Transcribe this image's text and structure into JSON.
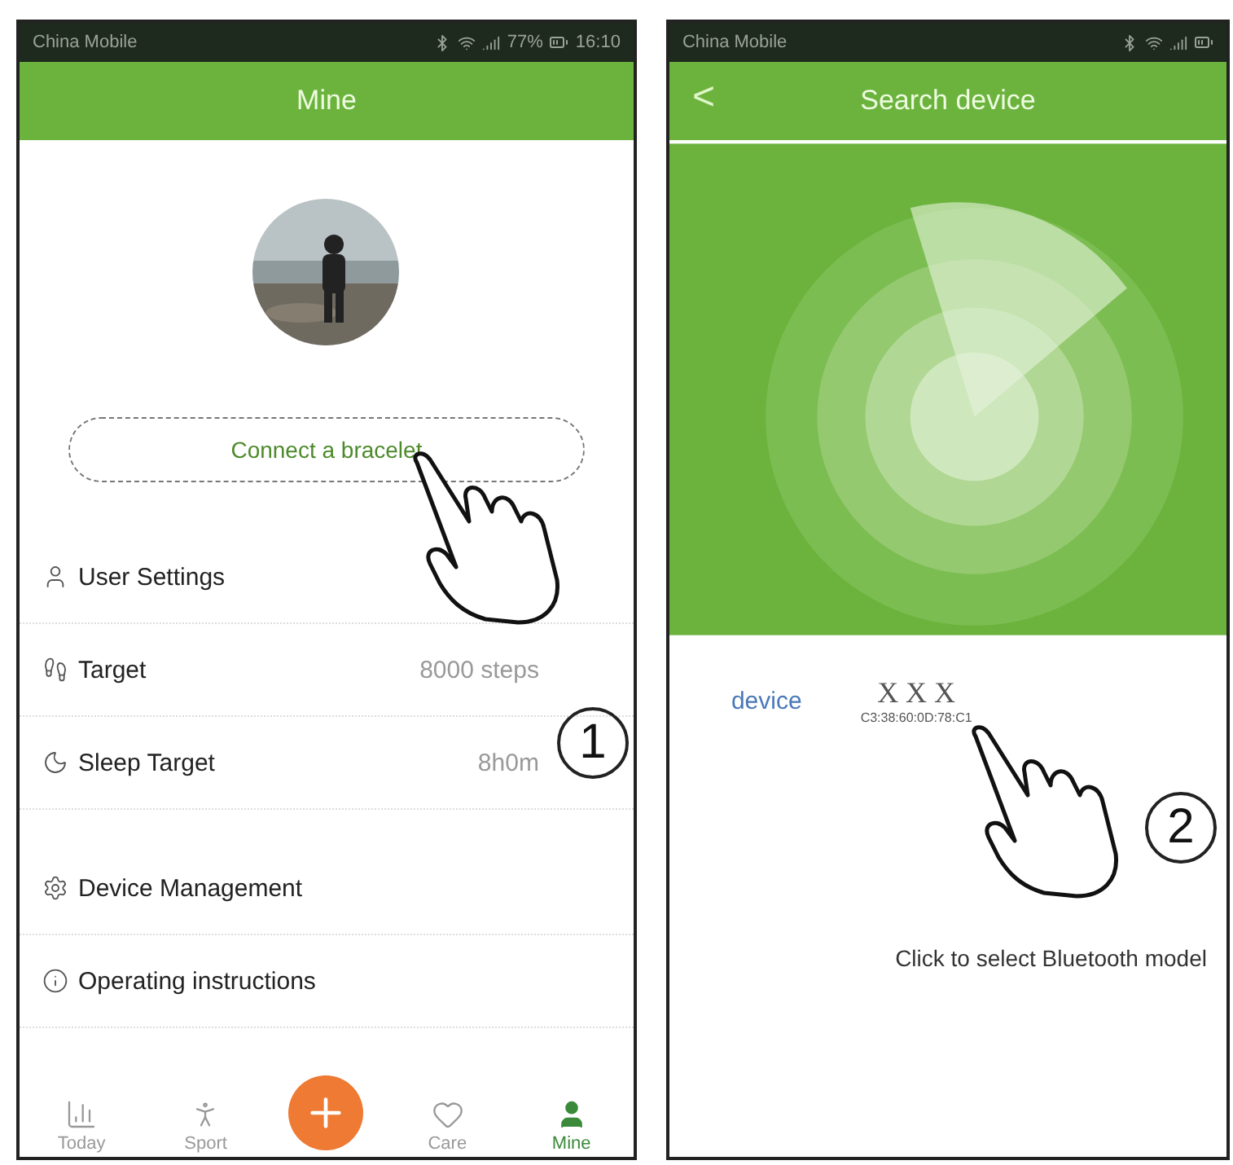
{
  "screens": [
    {
      "status_bar": {
        "carrier": "China Mobile",
        "battery": "77%",
        "time": "16:10"
      },
      "header": {
        "title": "Mine"
      },
      "connect_button": {
        "label": "Connect a bracelet"
      },
      "menu": [
        {
          "kind": "user",
          "label": "User Settings"
        },
        {
          "kind": "target",
          "label": "Target",
          "value": "8000 steps"
        },
        {
          "kind": "sleep",
          "label": "Sleep Target",
          "value": "8h0m"
        },
        {
          "kind": "device",
          "label": "Device Management"
        },
        {
          "kind": "info",
          "label": "Operating instructions"
        }
      ],
      "tabs": [
        {
          "kind": "today",
          "label": "Today",
          "selected": false
        },
        {
          "kind": "sport",
          "label": "Sport",
          "selected": false
        },
        {
          "kind": "add",
          "selected": false
        },
        {
          "kind": "care",
          "label": "Care",
          "selected": false
        },
        {
          "kind": "mine",
          "label": "Mine",
          "selected": true
        }
      ],
      "callout": "1"
    },
    {
      "status_bar": {
        "carrier": "China Mobile"
      },
      "header": {
        "title": "Search device",
        "back": "<"
      },
      "device_row": {
        "label": "device",
        "name": "X X X",
        "address": "C3:38:60:0D:78:C1"
      },
      "hint": "Click to select Bluetooth model",
      "callout": "2"
    }
  ]
}
